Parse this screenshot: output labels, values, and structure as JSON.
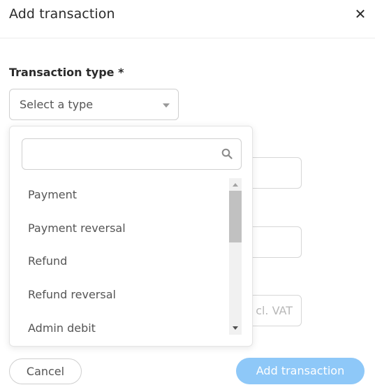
{
  "header": {
    "title": "Add transaction",
    "close_icon": "close-icon"
  },
  "transaction_type": {
    "label": "Transaction type *",
    "placeholder": "Select a type"
  },
  "dropdown": {
    "search_value": "",
    "search_icon": "search-icon",
    "options": [
      "Payment",
      "Payment reversal",
      "Refund",
      "Refund reversal",
      "Admin debit"
    ]
  },
  "background_fields": {
    "partial_placeholder": "cl. VAT"
  },
  "footer": {
    "cancel_label": "Cancel",
    "submit_label": "Add transaction"
  },
  "colors": {
    "primary_button_disabled": "#8ec8f8",
    "text": "#333333"
  }
}
